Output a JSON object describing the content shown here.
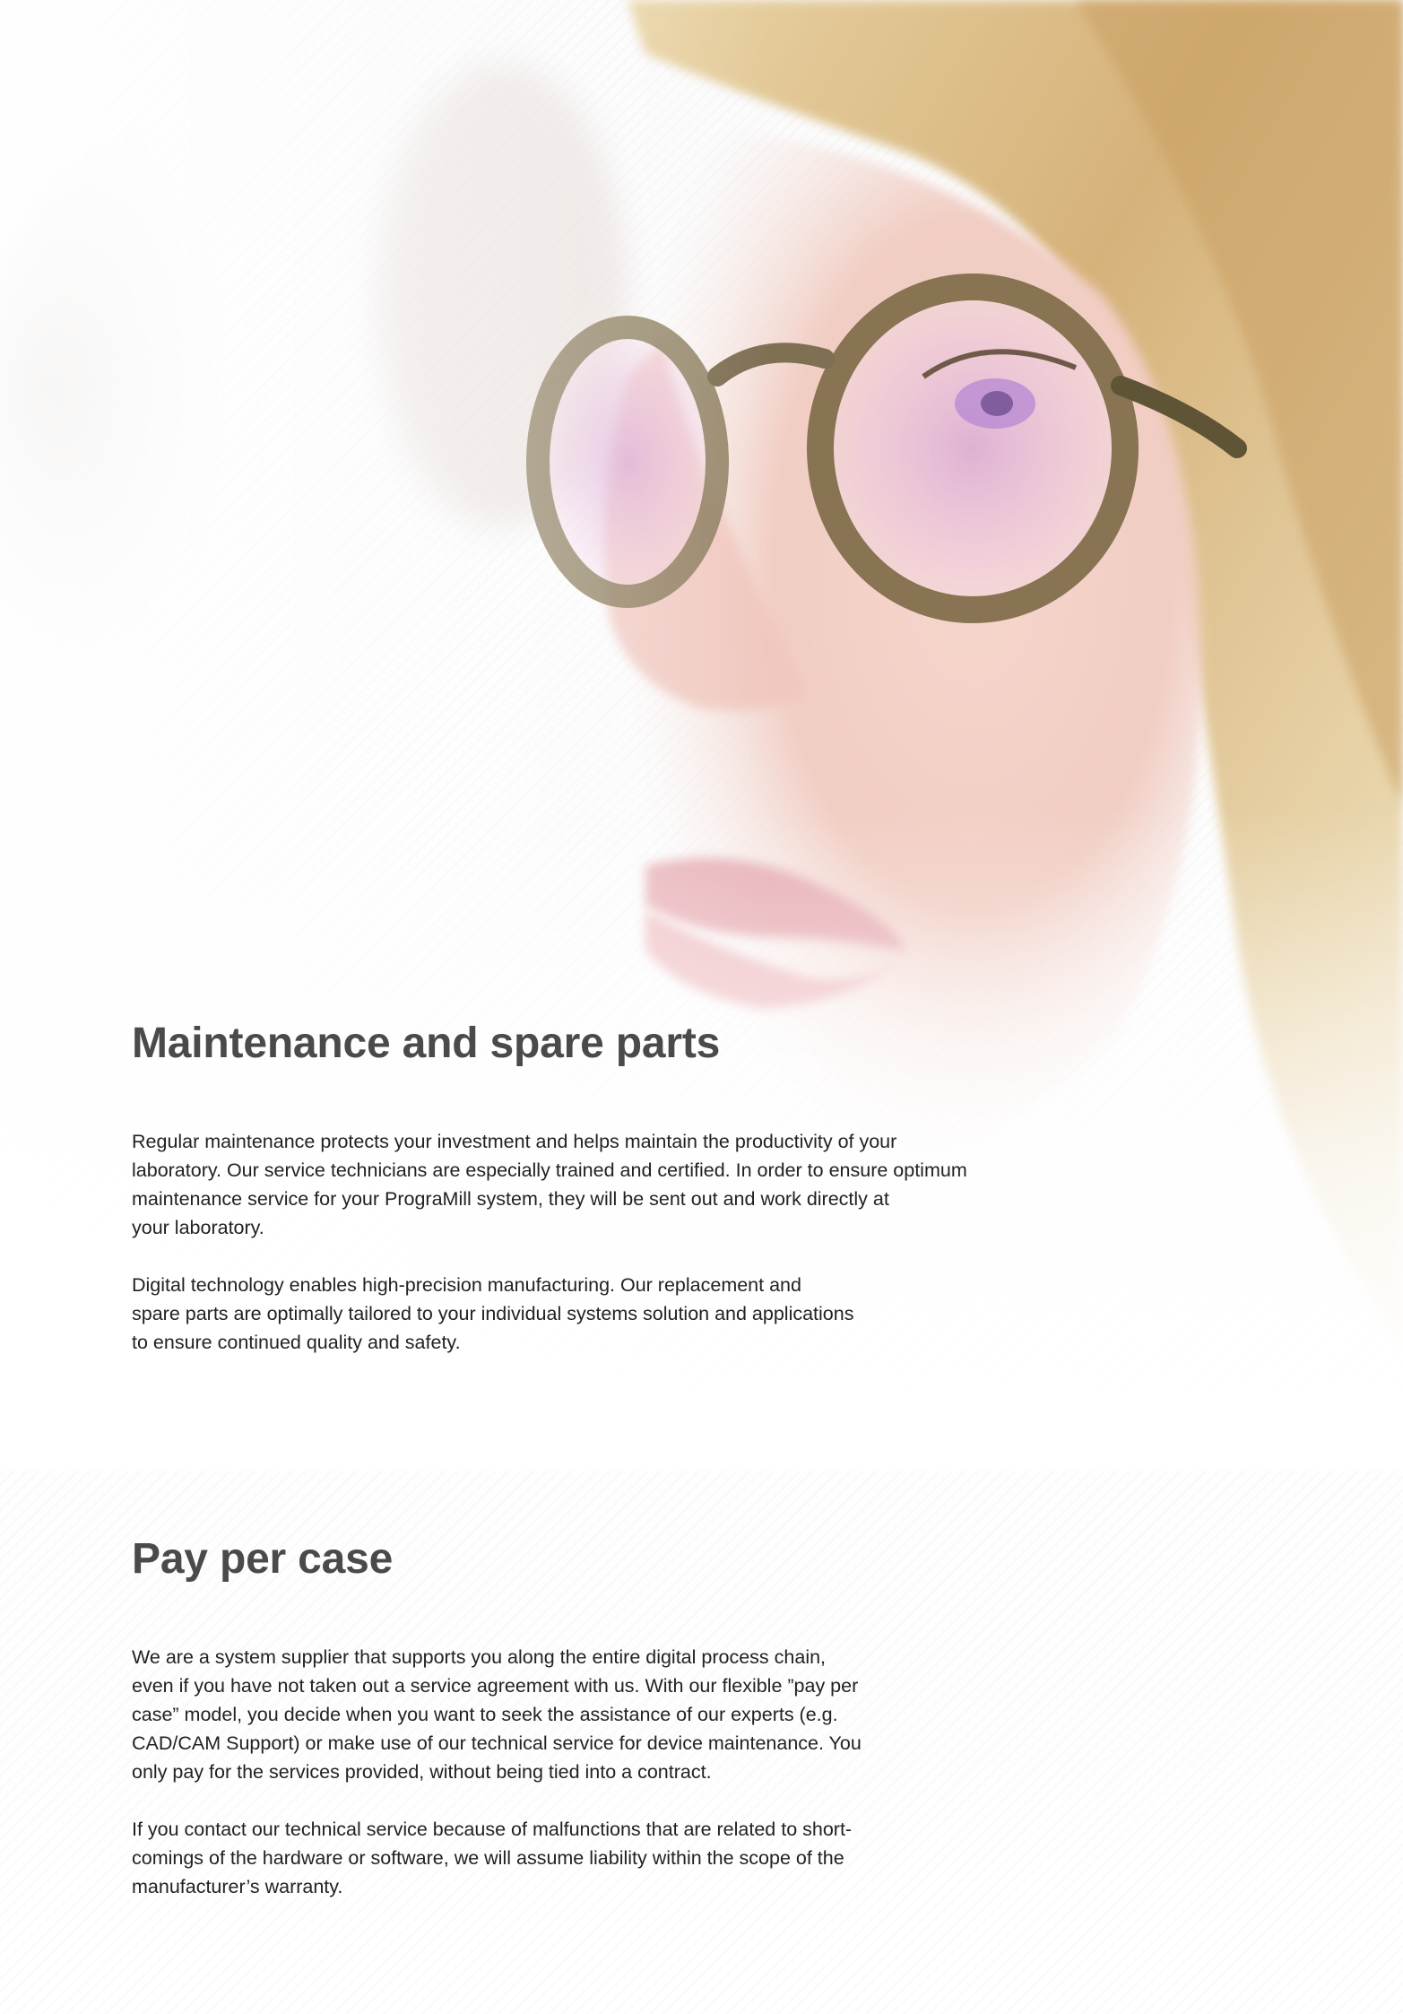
{
  "sections": [
    {
      "heading": "Maintenance and spare parts",
      "paragraphs": [
        "Regular maintenance protects your investment and helps maintain the productivity of your\nlaboratory. Our service technicians are especially trained and certified. In order to ensure optimum\nmaintenance service for your PrograMill system, they will be sent out and work directly at\nyour laboratory.",
        "Digital technology enables high-precision manufacturing. Our replacement and\nspare parts are optimally tailored to your individual systems solution and applications\nto ensure continued quality and safety."
      ]
    },
    {
      "heading": "Pay per case",
      "paragraphs": [
        "We are a system supplier that supports you along the entire digital process chain,\neven if you have not taken out a service agreement with us. With our flexible ”pay per\ncase” model, you decide when you want to seek the assistance of our experts (e.g.\nCAD/CAM Support) or make use of our technical service for device maintenance. You\nonly pay for the services provided, without being tied into a contract.",
        "If you contact our technical service because of malfunctions that are related to short-\ncomings of the hardware or software, we will assume liability within the scope of the\nmanufacturer’s warranty."
      ]
    }
  ],
  "colors": {
    "heading": "#4a4a4a",
    "body_text": "#222222",
    "background": "#ffffff"
  }
}
